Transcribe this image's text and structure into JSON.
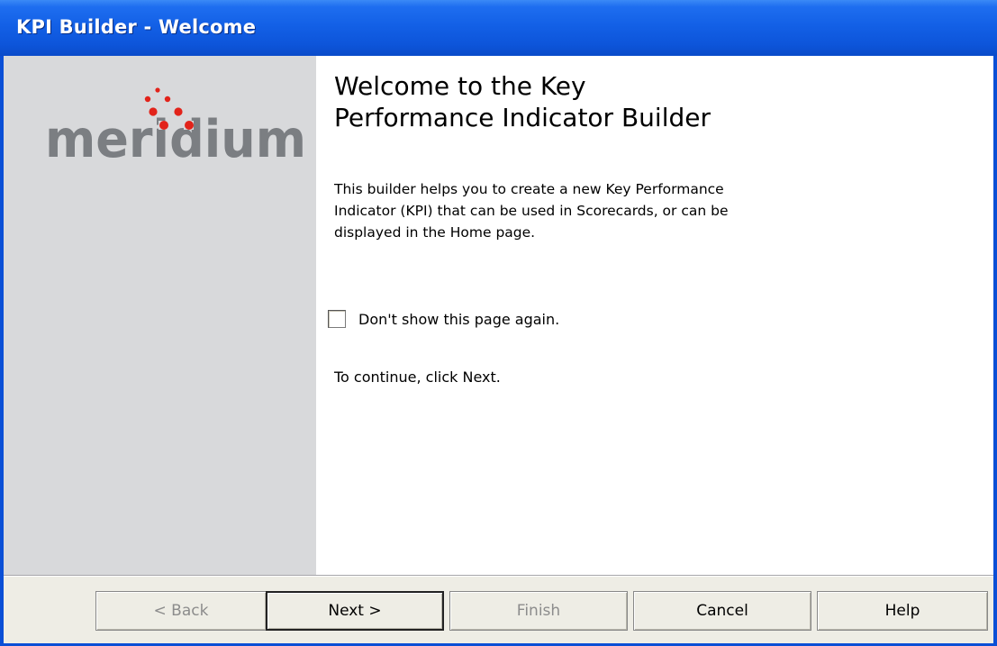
{
  "window": {
    "title": "KPI Builder - Welcome"
  },
  "sidebar": {
    "logo_text": "meridium"
  },
  "content": {
    "heading_line1": "Welcome to the Key",
    "heading_line2": "Performance Indicator Builder",
    "description_line1": "This builder helps you to create a new Key Performance",
    "description_line2": "Indicator (KPI) that can be used in Scorecards, or can be",
    "description_line3": "displayed in the Home page.",
    "checkbox_label": "Don't show this page again.",
    "checkbox_checked": false,
    "continue_text": "To continue, click Next."
  },
  "buttons": {
    "back": "< Back",
    "next": "Next >",
    "finish": "Finish",
    "cancel": "Cancel",
    "help": "Help"
  },
  "colors": {
    "title_bar": "#1360e6",
    "sidebar": "#d8d9db",
    "logo_text": "#7b7e82",
    "logo_dots": "#e2231a"
  }
}
